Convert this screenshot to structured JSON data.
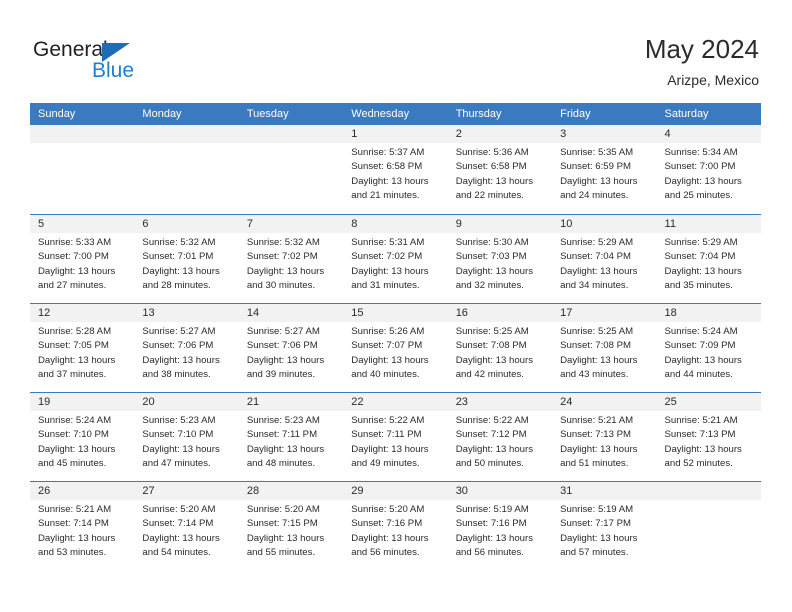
{
  "brand": {
    "name_part1": "General",
    "name_part2": "Blue",
    "triangle_icon": "triangle-icon",
    "color_dark": "#231f20",
    "color_blue": "#1e7fd4"
  },
  "header": {
    "title": "May 2024",
    "subtitle": "Arizpe, Mexico"
  },
  "theme": {
    "header_blue": "#3a7ac0",
    "daynum_band": "#f2f2f2",
    "text": "#2b2b2b"
  },
  "calendar": {
    "weekday_headers": [
      "Sunday",
      "Monday",
      "Tuesday",
      "Wednesday",
      "Thursday",
      "Friday",
      "Saturday"
    ],
    "weeks": [
      [
        {
          "day": "",
          "lines": []
        },
        {
          "day": "",
          "lines": []
        },
        {
          "day": "",
          "lines": []
        },
        {
          "day": "1",
          "lines": [
            "Sunrise: 5:37 AM",
            "Sunset: 6:58 PM",
            "Daylight: 13 hours",
            "and 21 minutes."
          ]
        },
        {
          "day": "2",
          "lines": [
            "Sunrise: 5:36 AM",
            "Sunset: 6:58 PM",
            "Daylight: 13 hours",
            "and 22 minutes."
          ]
        },
        {
          "day": "3",
          "lines": [
            "Sunrise: 5:35 AM",
            "Sunset: 6:59 PM",
            "Daylight: 13 hours",
            "and 24 minutes."
          ]
        },
        {
          "day": "4",
          "lines": [
            "Sunrise: 5:34 AM",
            "Sunset: 7:00 PM",
            "Daylight: 13 hours",
            "and 25 minutes."
          ]
        }
      ],
      [
        {
          "day": "5",
          "lines": [
            "Sunrise: 5:33 AM",
            "Sunset: 7:00 PM",
            "Daylight: 13 hours",
            "and 27 minutes."
          ]
        },
        {
          "day": "6",
          "lines": [
            "Sunrise: 5:32 AM",
            "Sunset: 7:01 PM",
            "Daylight: 13 hours",
            "and 28 minutes."
          ]
        },
        {
          "day": "7",
          "lines": [
            "Sunrise: 5:32 AM",
            "Sunset: 7:02 PM",
            "Daylight: 13 hours",
            "and 30 minutes."
          ]
        },
        {
          "day": "8",
          "lines": [
            "Sunrise: 5:31 AM",
            "Sunset: 7:02 PM",
            "Daylight: 13 hours",
            "and 31 minutes."
          ]
        },
        {
          "day": "9",
          "lines": [
            "Sunrise: 5:30 AM",
            "Sunset: 7:03 PM",
            "Daylight: 13 hours",
            "and 32 minutes."
          ]
        },
        {
          "day": "10",
          "lines": [
            "Sunrise: 5:29 AM",
            "Sunset: 7:04 PM",
            "Daylight: 13 hours",
            "and 34 minutes."
          ]
        },
        {
          "day": "11",
          "lines": [
            "Sunrise: 5:29 AM",
            "Sunset: 7:04 PM",
            "Daylight: 13 hours",
            "and 35 minutes."
          ]
        }
      ],
      [
        {
          "day": "12",
          "lines": [
            "Sunrise: 5:28 AM",
            "Sunset: 7:05 PM",
            "Daylight: 13 hours",
            "and 37 minutes."
          ]
        },
        {
          "day": "13",
          "lines": [
            "Sunrise: 5:27 AM",
            "Sunset: 7:06 PM",
            "Daylight: 13 hours",
            "and 38 minutes."
          ]
        },
        {
          "day": "14",
          "lines": [
            "Sunrise: 5:27 AM",
            "Sunset: 7:06 PM",
            "Daylight: 13 hours",
            "and 39 minutes."
          ]
        },
        {
          "day": "15",
          "lines": [
            "Sunrise: 5:26 AM",
            "Sunset: 7:07 PM",
            "Daylight: 13 hours",
            "and 40 minutes."
          ]
        },
        {
          "day": "16",
          "lines": [
            "Sunrise: 5:25 AM",
            "Sunset: 7:08 PM",
            "Daylight: 13 hours",
            "and 42 minutes."
          ]
        },
        {
          "day": "17",
          "lines": [
            "Sunrise: 5:25 AM",
            "Sunset: 7:08 PM",
            "Daylight: 13 hours",
            "and 43 minutes."
          ]
        },
        {
          "day": "18",
          "lines": [
            "Sunrise: 5:24 AM",
            "Sunset: 7:09 PM",
            "Daylight: 13 hours",
            "and 44 minutes."
          ]
        }
      ],
      [
        {
          "day": "19",
          "lines": [
            "Sunrise: 5:24 AM",
            "Sunset: 7:10 PM",
            "Daylight: 13 hours",
            "and 45 minutes."
          ]
        },
        {
          "day": "20",
          "lines": [
            "Sunrise: 5:23 AM",
            "Sunset: 7:10 PM",
            "Daylight: 13 hours",
            "and 47 minutes."
          ]
        },
        {
          "day": "21",
          "lines": [
            "Sunrise: 5:23 AM",
            "Sunset: 7:11 PM",
            "Daylight: 13 hours",
            "and 48 minutes."
          ]
        },
        {
          "day": "22",
          "lines": [
            "Sunrise: 5:22 AM",
            "Sunset: 7:11 PM",
            "Daylight: 13 hours",
            "and 49 minutes."
          ]
        },
        {
          "day": "23",
          "lines": [
            "Sunrise: 5:22 AM",
            "Sunset: 7:12 PM",
            "Daylight: 13 hours",
            "and 50 minutes."
          ]
        },
        {
          "day": "24",
          "lines": [
            "Sunrise: 5:21 AM",
            "Sunset: 7:13 PM",
            "Daylight: 13 hours",
            "and 51 minutes."
          ]
        },
        {
          "day": "25",
          "lines": [
            "Sunrise: 5:21 AM",
            "Sunset: 7:13 PM",
            "Daylight: 13 hours",
            "and 52 minutes."
          ]
        }
      ],
      [
        {
          "day": "26",
          "lines": [
            "Sunrise: 5:21 AM",
            "Sunset: 7:14 PM",
            "Daylight: 13 hours",
            "and 53 minutes."
          ]
        },
        {
          "day": "27",
          "lines": [
            "Sunrise: 5:20 AM",
            "Sunset: 7:14 PM",
            "Daylight: 13 hours",
            "and 54 minutes."
          ]
        },
        {
          "day": "28",
          "lines": [
            "Sunrise: 5:20 AM",
            "Sunset: 7:15 PM",
            "Daylight: 13 hours",
            "and 55 minutes."
          ]
        },
        {
          "day": "29",
          "lines": [
            "Sunrise: 5:20 AM",
            "Sunset: 7:16 PM",
            "Daylight: 13 hours",
            "and 56 minutes."
          ]
        },
        {
          "day": "30",
          "lines": [
            "Sunrise: 5:19 AM",
            "Sunset: 7:16 PM",
            "Daylight: 13 hours",
            "and 56 minutes."
          ]
        },
        {
          "day": "31",
          "lines": [
            "Sunrise: 5:19 AM",
            "Sunset: 7:17 PM",
            "Daylight: 13 hours",
            "and 57 minutes."
          ]
        },
        {
          "day": "",
          "lines": []
        }
      ]
    ]
  }
}
